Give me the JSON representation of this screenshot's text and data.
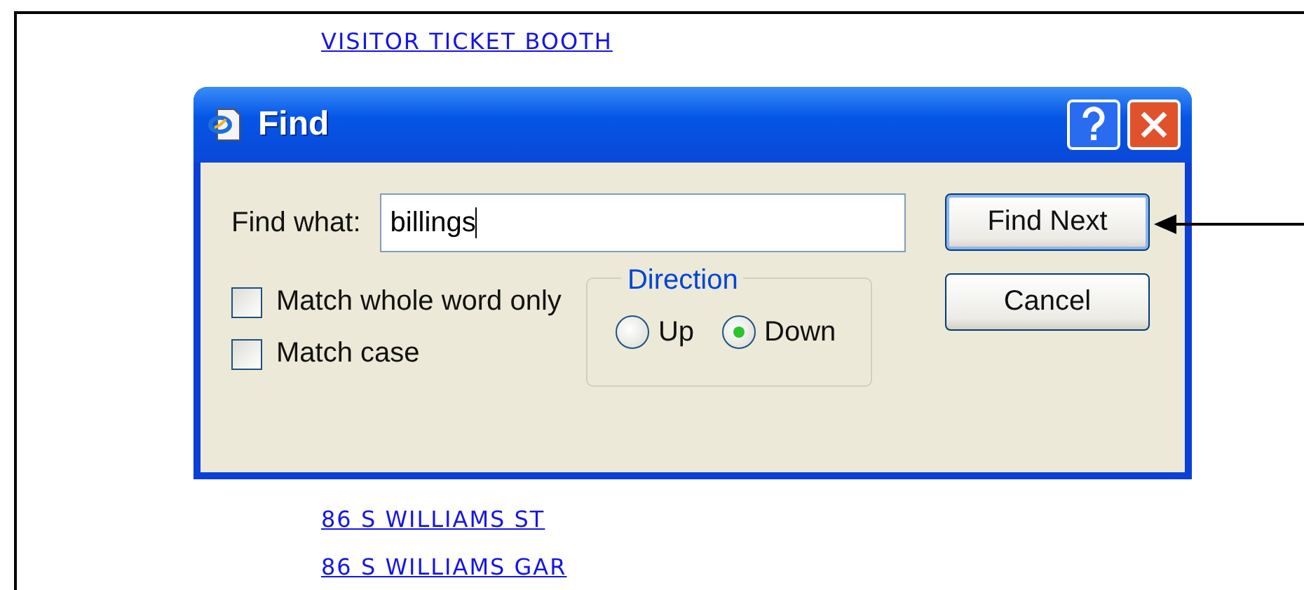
{
  "links_top": [
    "VISITOR TICKET BOOTH"
  ],
  "links_bottom": [
    "86 S WILLIAMS ST",
    "86 S WILLIAMS GAR"
  ],
  "dialog": {
    "title": "Find",
    "find_label": "Find what:",
    "find_value": "billings",
    "checkboxes": [
      {
        "label": "Match whole word only",
        "checked": false
      },
      {
        "label": "Match case",
        "checked": false
      }
    ],
    "direction": {
      "title": "Direction",
      "options": [
        {
          "label": "Up",
          "selected": false
        },
        {
          "label": "Down",
          "selected": true
        }
      ]
    },
    "buttons": [
      {
        "label": "Find Next",
        "focused": true
      },
      {
        "label": "Cancel",
        "focused": false
      }
    ]
  }
}
